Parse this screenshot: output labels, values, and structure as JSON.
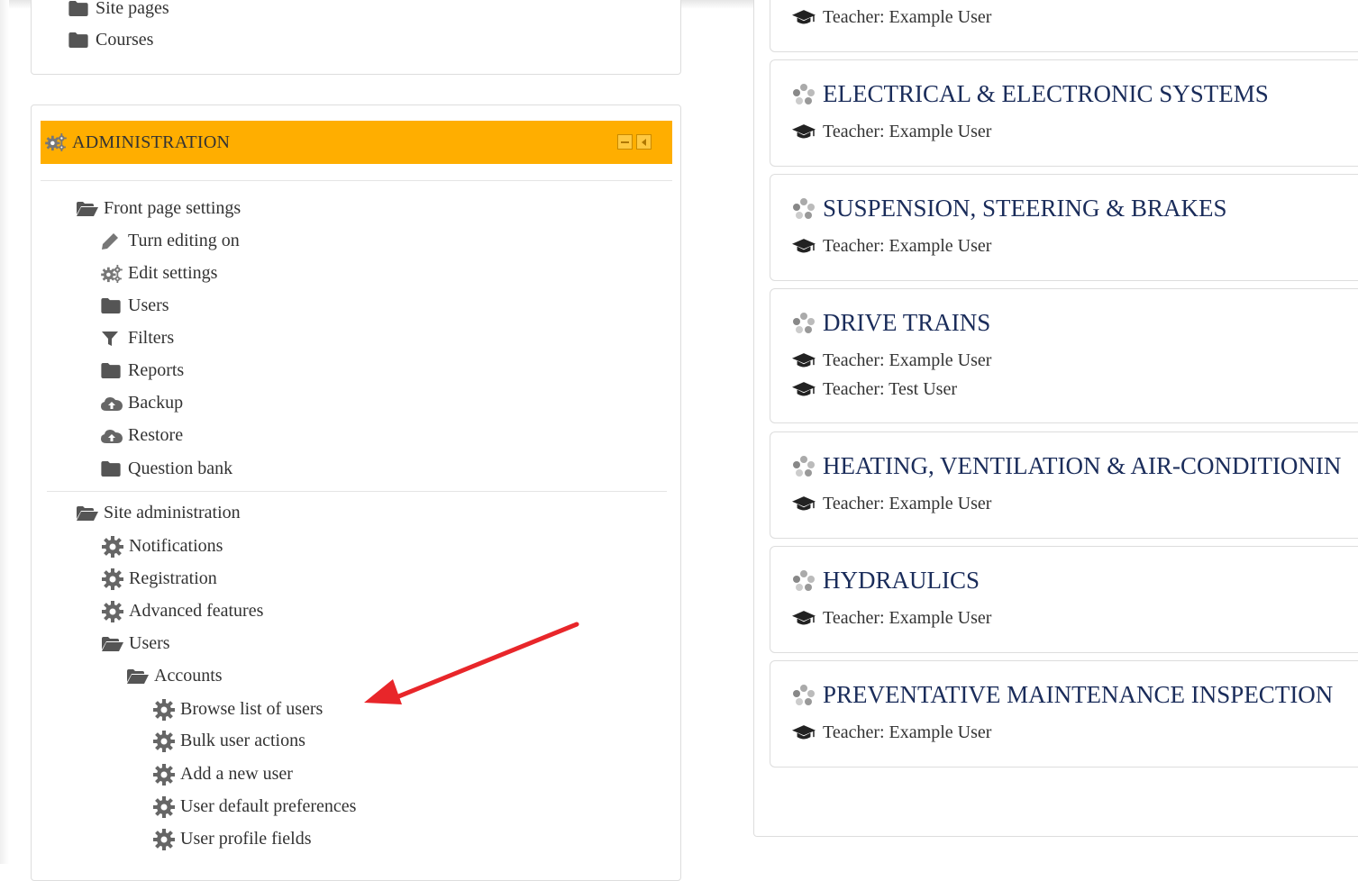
{
  "colors": {
    "admin_header_bg": "#ffae00",
    "course_title": "#1a2c5a",
    "arrow": "#e8262a",
    "folder_icon": "#555555",
    "gear_icon": "#666666"
  },
  "nav_block": {
    "items": [
      {
        "label": "Site pages",
        "icon": "folder-icon"
      },
      {
        "label": "Courses",
        "icon": "folder-icon"
      }
    ]
  },
  "admin_block": {
    "title": "ADMINISTRATION",
    "front_page": {
      "label": "Front page settings",
      "items": [
        {
          "label": "Turn editing on",
          "icon": "pencil-icon"
        },
        {
          "label": "Edit settings",
          "icon": "gears-icon"
        },
        {
          "label": "Users",
          "icon": "folder-icon"
        },
        {
          "label": "Filters",
          "icon": "filter-icon"
        },
        {
          "label": "Reports",
          "icon": "folder-icon"
        },
        {
          "label": "Backup",
          "icon": "cloud-upload-icon"
        },
        {
          "label": "Restore",
          "icon": "cloud-upload-icon"
        },
        {
          "label": "Question bank",
          "icon": "folder-icon"
        }
      ]
    },
    "site_admin": {
      "label": "Site administration",
      "items": [
        {
          "label": "Notifications",
          "icon": "gear-icon"
        },
        {
          "label": "Registration",
          "icon": "gear-icon"
        },
        {
          "label": "Advanced features",
          "icon": "gear-icon"
        }
      ],
      "users_label": "Users",
      "accounts_label": "Accounts",
      "account_items": [
        {
          "label": "Browse list of users",
          "icon": "gear-icon"
        },
        {
          "label": "Bulk user actions",
          "icon": "gear-icon"
        },
        {
          "label": "Add a new user",
          "icon": "gear-icon"
        },
        {
          "label": "User default preferences",
          "icon": "gear-icon"
        },
        {
          "label": "User profile fields",
          "icon": "gear-icon"
        }
      ]
    }
  },
  "courses": [
    {
      "title": "",
      "teachers": [
        "Teacher: Example User"
      ]
    },
    {
      "title": "ELECTRICAL & ELECTRONIC SYSTEMS",
      "teachers": [
        "Teacher: Example User"
      ]
    },
    {
      "title": "SUSPENSION, STEERING & BRAKES",
      "teachers": [
        "Teacher: Example User"
      ]
    },
    {
      "title": "DRIVE TRAINS",
      "teachers": [
        "Teacher: Example User",
        "Teacher: Test User"
      ]
    },
    {
      "title": "HEATING, VENTILATION & AIR-CONDITIONIN",
      "teachers": [
        "Teacher: Example User"
      ]
    },
    {
      "title": "HYDRAULICS",
      "teachers": [
        "Teacher: Example User"
      ]
    },
    {
      "title": "PREVENTATIVE MAINTENANCE INSPECTION",
      "teachers": [
        "Teacher: Example User"
      ]
    }
  ]
}
